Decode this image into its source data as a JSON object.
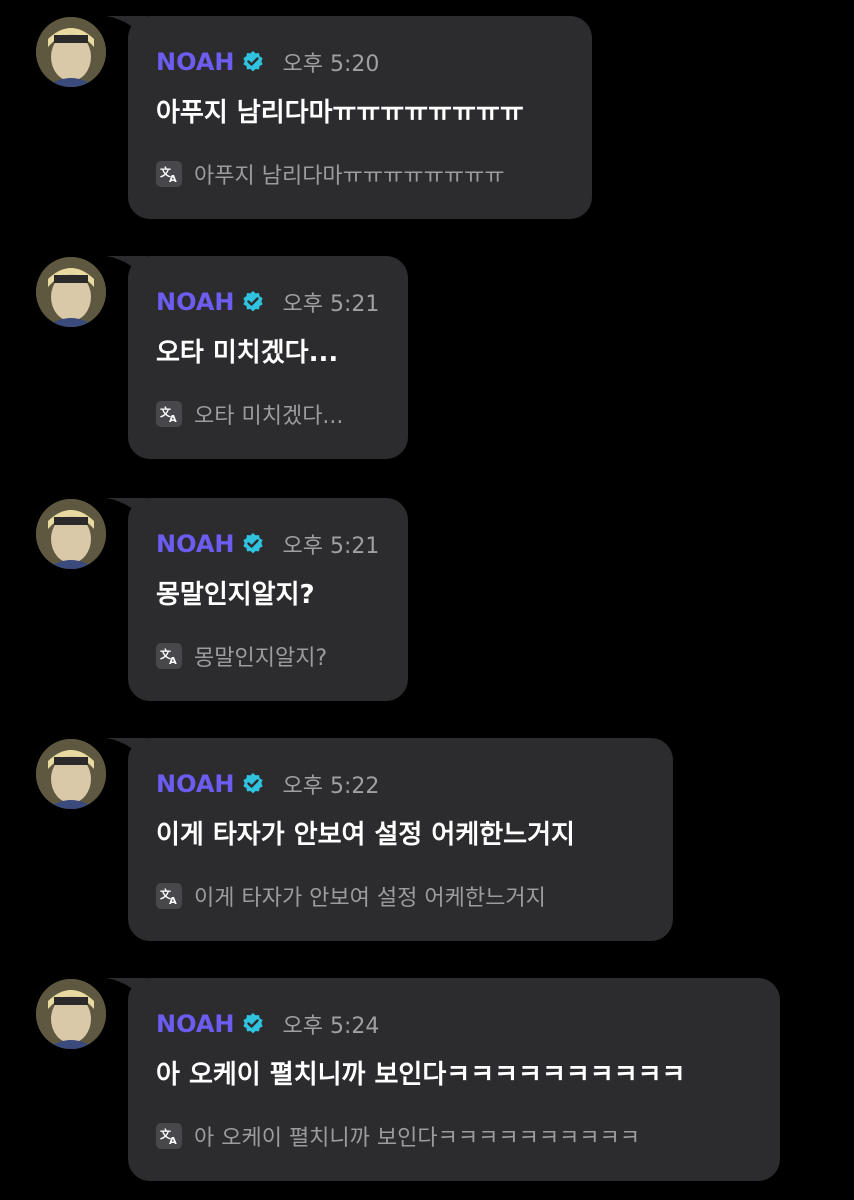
{
  "messages": [
    {
      "name": "NOAH",
      "time": "오후 5:20",
      "text": "아푸지 남리다마ㅠㅠㅠㅠㅠㅠㅠㅠ",
      "translation": "아푸지 남리다마ㅠㅠㅠㅠㅠㅠㅠㅠ"
    },
    {
      "name": "NOAH",
      "time": "오후 5:21",
      "text": "오타 미치겠다...",
      "translation": "오타 미치겠다..."
    },
    {
      "name": "NOAH",
      "time": "오후 5:21",
      "text": "몽말인지알지?",
      "translation": "몽말인지알지?"
    },
    {
      "name": "NOAH",
      "time": "오후 5:22",
      "text": "이게 타자가 안보여 설정 어케한느거지",
      "translation": "이게 타자가 안보여 설정 어케한느거지"
    },
    {
      "name": "NOAH",
      "time": "오후 5:24",
      "text": "아 오케이 펼치니까 보인다ㅋㅋㅋㅋㅋㅋㅋㅋㅋㅋ",
      "translation": "아 오케이 펼치니까 보인다ㅋㅋㅋㅋㅋㅋㅋㅋㅋㅋ"
    }
  ],
  "icons": {
    "verified": "verified-badge-icon",
    "translate": "translate-icon"
  },
  "colors": {
    "background": "#000000",
    "bubble": "#2c2c2e",
    "name": "#6c5cf0",
    "verified": "#2fc3e0",
    "time": "#a0a0a4",
    "text": "#ffffff",
    "translation": "#9c9ca0"
  }
}
